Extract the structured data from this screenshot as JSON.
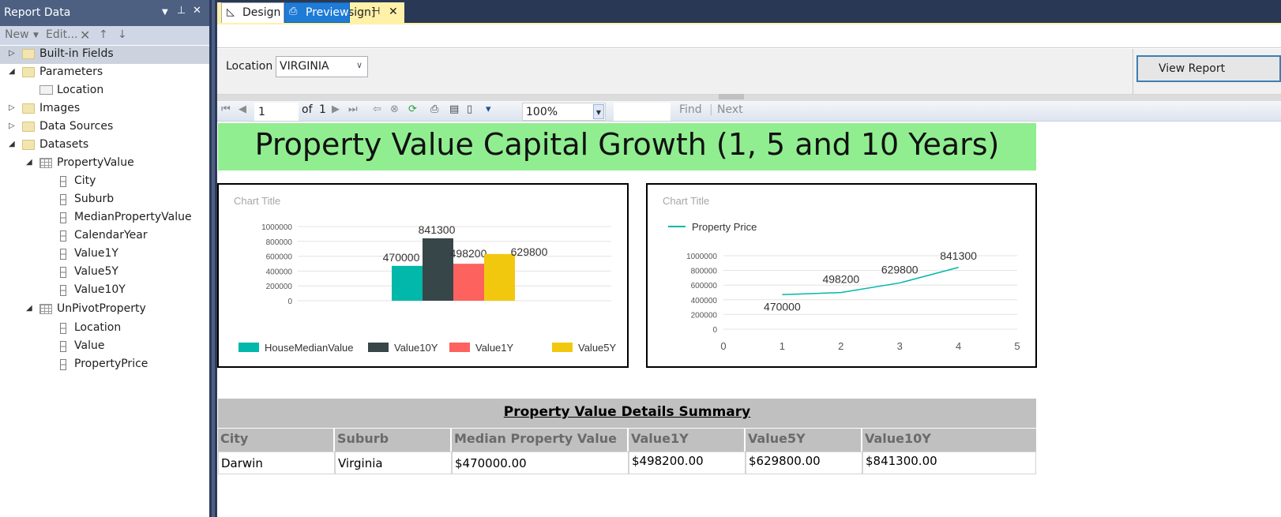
{
  "report_data_panel": {
    "title": "Report Data",
    "toolbar": {
      "new_label": "New",
      "edit_label": "Edit..."
    },
    "tree": {
      "builtin_fields": "Built-in Fields",
      "parameters": "Parameters",
      "param_location": "Location",
      "images": "Images",
      "data_sources": "Data Sources",
      "datasets": "Datasets",
      "ds1": "PropertyValue",
      "ds1_fields": [
        "City",
        "Suburb",
        "MedianPropertyValue",
        "CalendarYear",
        "Value1Y",
        "Value5Y",
        "Value10Y"
      ],
      "ds2": "UnPivotProperty",
      "ds2_fields": [
        "Location",
        "Value",
        "PropertyPrice"
      ]
    }
  },
  "document": {
    "tab_label": "PropertyGrowth.rdl [Design]",
    "design_tab": "Design",
    "preview_tab": "Preview"
  },
  "parameters": {
    "location_label": "Location",
    "location_value": "VIRGINIA",
    "view_report": "View Report"
  },
  "nav_toolbar": {
    "page": "1",
    "of_label": "of",
    "total_pages": "1",
    "zoom": "100%",
    "find_label": "Find",
    "next_label": "Next"
  },
  "report": {
    "title": "Property Value Capital Growth (1, 5 and 10 Years)",
    "summary_title": "Property Value Details Summary",
    "table": {
      "headers": [
        "City",
        "Suburb",
        "Median Property Value",
        "Value1Y",
        "Value5Y",
        "Value10Y"
      ],
      "rows": [
        [
          "Darwin",
          "Virginia",
          "$470000.00",
          "$498200.00",
          "$629800.00",
          "$841300.00"
        ]
      ]
    }
  },
  "chart_data": [
    {
      "type": "bar",
      "title": "Chart Title",
      "categories": [
        ""
      ],
      "series": [
        {
          "name": "HouseMedianValue",
          "values": [
            470000
          ],
          "color": "#01b8aa"
        },
        {
          "name": "Value10Y",
          "values": [
            841300
          ],
          "color": "#374649"
        },
        {
          "name": "Value1Y",
          "values": [
            498200
          ],
          "color": "#fd625e"
        },
        {
          "name": "Value5Y",
          "values": [
            629800
          ],
          "color": "#f2c80f"
        }
      ],
      "yticks": [
        0,
        200000,
        400000,
        600000,
        800000,
        1000000
      ],
      "ylim": [
        0,
        1000000
      ],
      "data_labels": true,
      "legend": "bottom"
    },
    {
      "type": "line",
      "title": "Chart Title",
      "series": [
        {
          "name": "Property Price",
          "x": [
            1,
            2,
            3,
            4
          ],
          "values": [
            470000,
            498200,
            629800,
            841300
          ],
          "color": "#01b8aa"
        }
      ],
      "xticks": [
        0,
        1,
        2,
        3,
        4,
        5
      ],
      "xlim": [
        0,
        5
      ],
      "yticks": [
        0,
        200000,
        400000,
        600000,
        800000,
        1000000
      ],
      "ylim": [
        0,
        1000000
      ],
      "data_labels": true,
      "legend": "top-left"
    }
  ]
}
